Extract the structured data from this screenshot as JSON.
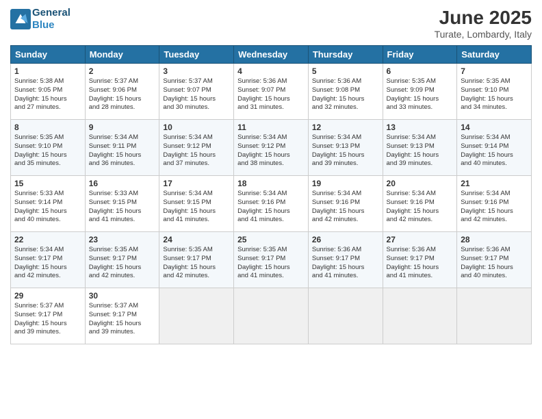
{
  "header": {
    "logo_line1": "General",
    "logo_line2": "Blue",
    "month_title": "June 2025",
    "location": "Turate, Lombardy, Italy"
  },
  "days_of_week": [
    "Sunday",
    "Monday",
    "Tuesday",
    "Wednesday",
    "Thursday",
    "Friday",
    "Saturday"
  ],
  "weeks": [
    [
      {
        "day": "1",
        "info": "Sunrise: 5:38 AM\nSunset: 9:05 PM\nDaylight: 15 hours\nand 27 minutes."
      },
      {
        "day": "2",
        "info": "Sunrise: 5:37 AM\nSunset: 9:06 PM\nDaylight: 15 hours\nand 28 minutes."
      },
      {
        "day": "3",
        "info": "Sunrise: 5:37 AM\nSunset: 9:07 PM\nDaylight: 15 hours\nand 30 minutes."
      },
      {
        "day": "4",
        "info": "Sunrise: 5:36 AM\nSunset: 9:07 PM\nDaylight: 15 hours\nand 31 minutes."
      },
      {
        "day": "5",
        "info": "Sunrise: 5:36 AM\nSunset: 9:08 PM\nDaylight: 15 hours\nand 32 minutes."
      },
      {
        "day": "6",
        "info": "Sunrise: 5:35 AM\nSunset: 9:09 PM\nDaylight: 15 hours\nand 33 minutes."
      },
      {
        "day": "7",
        "info": "Sunrise: 5:35 AM\nSunset: 9:10 PM\nDaylight: 15 hours\nand 34 minutes."
      }
    ],
    [
      {
        "day": "8",
        "info": "Sunrise: 5:35 AM\nSunset: 9:10 PM\nDaylight: 15 hours\nand 35 minutes."
      },
      {
        "day": "9",
        "info": "Sunrise: 5:34 AM\nSunset: 9:11 PM\nDaylight: 15 hours\nand 36 minutes."
      },
      {
        "day": "10",
        "info": "Sunrise: 5:34 AM\nSunset: 9:12 PM\nDaylight: 15 hours\nand 37 minutes."
      },
      {
        "day": "11",
        "info": "Sunrise: 5:34 AM\nSunset: 9:12 PM\nDaylight: 15 hours\nand 38 minutes."
      },
      {
        "day": "12",
        "info": "Sunrise: 5:34 AM\nSunset: 9:13 PM\nDaylight: 15 hours\nand 39 minutes."
      },
      {
        "day": "13",
        "info": "Sunrise: 5:34 AM\nSunset: 9:13 PM\nDaylight: 15 hours\nand 39 minutes."
      },
      {
        "day": "14",
        "info": "Sunrise: 5:34 AM\nSunset: 9:14 PM\nDaylight: 15 hours\nand 40 minutes."
      }
    ],
    [
      {
        "day": "15",
        "info": "Sunrise: 5:33 AM\nSunset: 9:14 PM\nDaylight: 15 hours\nand 40 minutes."
      },
      {
        "day": "16",
        "info": "Sunrise: 5:33 AM\nSunset: 9:15 PM\nDaylight: 15 hours\nand 41 minutes."
      },
      {
        "day": "17",
        "info": "Sunrise: 5:34 AM\nSunset: 9:15 PM\nDaylight: 15 hours\nand 41 minutes."
      },
      {
        "day": "18",
        "info": "Sunrise: 5:34 AM\nSunset: 9:16 PM\nDaylight: 15 hours\nand 41 minutes."
      },
      {
        "day": "19",
        "info": "Sunrise: 5:34 AM\nSunset: 9:16 PM\nDaylight: 15 hours\nand 42 minutes."
      },
      {
        "day": "20",
        "info": "Sunrise: 5:34 AM\nSunset: 9:16 PM\nDaylight: 15 hours\nand 42 minutes."
      },
      {
        "day": "21",
        "info": "Sunrise: 5:34 AM\nSunset: 9:16 PM\nDaylight: 15 hours\nand 42 minutes."
      }
    ],
    [
      {
        "day": "22",
        "info": "Sunrise: 5:34 AM\nSunset: 9:17 PM\nDaylight: 15 hours\nand 42 minutes."
      },
      {
        "day": "23",
        "info": "Sunrise: 5:35 AM\nSunset: 9:17 PM\nDaylight: 15 hours\nand 42 minutes."
      },
      {
        "day": "24",
        "info": "Sunrise: 5:35 AM\nSunset: 9:17 PM\nDaylight: 15 hours\nand 42 minutes."
      },
      {
        "day": "25",
        "info": "Sunrise: 5:35 AM\nSunset: 9:17 PM\nDaylight: 15 hours\nand 41 minutes."
      },
      {
        "day": "26",
        "info": "Sunrise: 5:36 AM\nSunset: 9:17 PM\nDaylight: 15 hours\nand 41 minutes."
      },
      {
        "day": "27",
        "info": "Sunrise: 5:36 AM\nSunset: 9:17 PM\nDaylight: 15 hours\nand 41 minutes."
      },
      {
        "day": "28",
        "info": "Sunrise: 5:36 AM\nSunset: 9:17 PM\nDaylight: 15 hours\nand 40 minutes."
      }
    ],
    [
      {
        "day": "29",
        "info": "Sunrise: 5:37 AM\nSunset: 9:17 PM\nDaylight: 15 hours\nand 39 minutes."
      },
      {
        "day": "30",
        "info": "Sunrise: 5:37 AM\nSunset: 9:17 PM\nDaylight: 15 hours\nand 39 minutes."
      },
      {
        "day": "",
        "info": ""
      },
      {
        "day": "",
        "info": ""
      },
      {
        "day": "",
        "info": ""
      },
      {
        "day": "",
        "info": ""
      },
      {
        "day": "",
        "info": ""
      }
    ]
  ]
}
